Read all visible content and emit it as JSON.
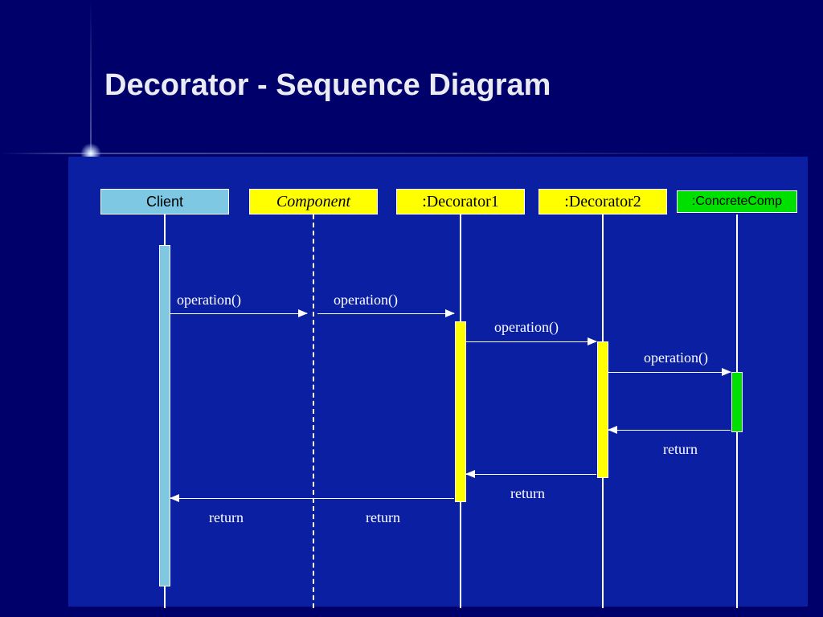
{
  "title": "Decorator - Sequence Diagram",
  "participants": {
    "client": "Client",
    "component": "Component",
    "decorator1": ":Decorator1",
    "decorator2": ":Decorator2",
    "concrete": ":ConcreteComp"
  },
  "messages": {
    "op1": "operation()",
    "op2": "operation()",
    "op3": "operation()",
    "op4": "operation()",
    "ret1": "return",
    "ret2": "return",
    "ret3a": "return",
    "ret3b": "return"
  },
  "chart_data": {
    "type": "sequence_diagram",
    "title": "Decorator - Sequence Diagram",
    "participants": [
      {
        "name": "Client",
        "color": "#7ec8e3"
      },
      {
        "name": "Component",
        "color": "#ffff00",
        "abstract": true,
        "lifeline": "dashed"
      },
      {
        "name": ":Decorator1",
        "color": "#ffff00"
      },
      {
        "name": ":Decorator2",
        "color": "#ffff00"
      },
      {
        "name": ":ConcreteComp",
        "color": "#00e000"
      }
    ],
    "messages": [
      {
        "from": "Client",
        "to": "Component",
        "label": "operation()",
        "type": "call"
      },
      {
        "from": "Component",
        "to": ":Decorator1",
        "label": "operation()",
        "type": "call"
      },
      {
        "from": ":Decorator1",
        "to": ":Decorator2",
        "label": "operation()",
        "type": "call"
      },
      {
        "from": ":Decorator2",
        "to": ":ConcreteComp",
        "label": "operation()",
        "type": "call"
      },
      {
        "from": ":ConcreteComp",
        "to": ":Decorator2",
        "label": "return",
        "type": "return"
      },
      {
        "from": ":Decorator2",
        "to": ":Decorator1",
        "label": "return",
        "type": "return"
      },
      {
        "from": ":Decorator1",
        "to": "Client",
        "label": "return",
        "type": "return",
        "via": "Component"
      }
    ]
  }
}
